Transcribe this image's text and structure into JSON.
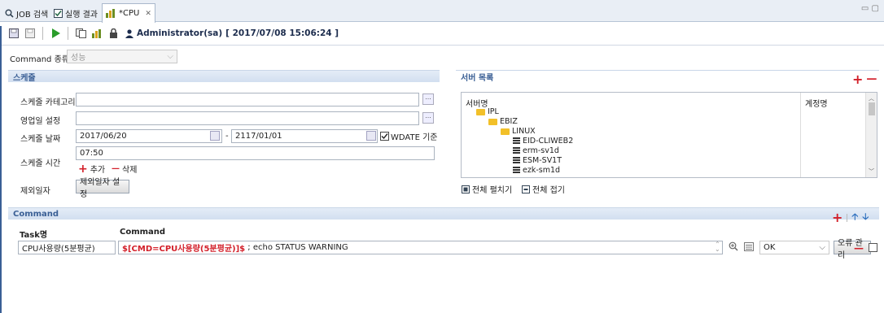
{
  "tabs": [
    {
      "label": "JOB 검색"
    },
    {
      "label": "실행 결과"
    },
    {
      "label": "*CPU"
    }
  ],
  "toolbar": {
    "user": "Administrator(sa)",
    "timestamp": "[ 2017/07/08 15:06:24 ]"
  },
  "command_type": {
    "label": "Command 종류",
    "value": "성능"
  },
  "schedule": {
    "title": "스케줄",
    "category_label": "스케줄 카테고리",
    "category_value": "",
    "business_label": "영업일 설정",
    "business_value": "",
    "date_label": "스케줄 날짜",
    "date_from": "2017/06/20",
    "date_sep": "-",
    "date_to": "2117/01/01",
    "wdate_label": "WDATE 기준",
    "wdate_checked": true,
    "time_label": "스케줄 시간",
    "time_value": "07:50",
    "add_label": "추가",
    "delete_label": "삭제",
    "exclude_label": "제외일자",
    "exclude_button": "제외일자 설정"
  },
  "servers": {
    "title": "서버 목록",
    "col_server": "서버명",
    "col_account": "계정명",
    "tree": [
      {
        "label": "IPL",
        "type": "folder",
        "depth": 0
      },
      {
        "label": "EBIZ",
        "type": "folder",
        "depth": 1
      },
      {
        "label": "LINUX",
        "type": "folder",
        "depth": 2
      },
      {
        "label": "EID-CLIWEB2",
        "type": "server",
        "depth": 3
      },
      {
        "label": "erm-sv1d",
        "type": "server",
        "depth": 3
      },
      {
        "label": "ESM-SV1T",
        "type": "server",
        "depth": 3
      },
      {
        "label": "ezk-sm1d",
        "type": "server",
        "depth": 3
      }
    ],
    "expand_all": "전체 펼치기",
    "collapse_all": "전체 접기"
  },
  "command": {
    "title": "Command",
    "col_task": "Task명",
    "col_command": "Command",
    "rows": [
      {
        "task": "CPU사용량(5분평균)",
        "cmd_highlight": "$[CMD=CPU사용량(5분평균)]$",
        "cmd_rest": " ; echo STATUS WARNING",
        "status": "OK",
        "error_button": "오류 관리"
      }
    ]
  },
  "colors": {
    "accent": "#3a5f95",
    "red": "#d3202a",
    "section_bg": "#d8e4f3"
  }
}
